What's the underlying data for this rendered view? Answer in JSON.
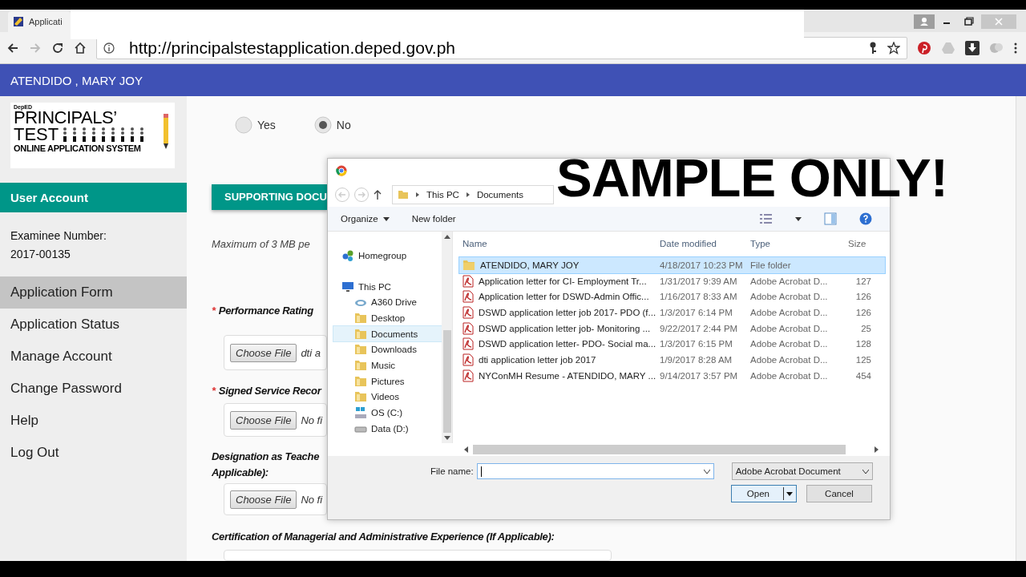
{
  "browser": {
    "tab_title": "Applicati",
    "url": "http://principalstestapplication.deped.gov.ph"
  },
  "header": {
    "user_name": "ATENDIDO , MARY JOY"
  },
  "sidebar": {
    "logo": {
      "agency": "DepED",
      "line1": "PRINCIPALS’",
      "line2": "TEST",
      "line3": "ONLINE APPLICATION SYSTEM"
    },
    "section_title": "User Account",
    "examinee_label": "Examinee Number:",
    "examinee_number": "2017-00135",
    "items": [
      {
        "label": "Application Form",
        "selected": true
      },
      {
        "label": "Application Status",
        "selected": false
      },
      {
        "label": "Manage Account",
        "selected": false
      },
      {
        "label": "Change Password",
        "selected": false
      },
      {
        "label": "Help",
        "selected": false
      },
      {
        "label": "Log Out",
        "selected": false
      }
    ]
  },
  "form": {
    "radios": [
      {
        "label": "Yes",
        "selected": false
      },
      {
        "label": "No",
        "selected": true
      }
    ],
    "section_button": "SUPPORTING DOCU",
    "note": "Maximum of 3 MB pe",
    "fields": [
      {
        "mark": "*",
        "label_lines": [
          "Performance Rating"
        ],
        "button": "Choose File",
        "file": "dti a"
      },
      {
        "mark": "*",
        "label_lines": [
          "Signed Service Recor"
        ],
        "button": "Choose File",
        "file": "No fi"
      },
      {
        "label_lines": [
          "Designation as Teache",
          "Applicable):"
        ],
        "button": "Choose File",
        "file": "No fi"
      },
      {
        "label_lines": [
          "Certification of Managerial and Administrative Experience (If Applicable):"
        ]
      }
    ]
  },
  "dialog": {
    "breadcrumb": [
      "This PC",
      "Documents"
    ],
    "toolbar": [
      "Organize",
      "New folder"
    ],
    "nav": [
      {
        "label": "Homegroup",
        "kind": "homegroup",
        "selected": false
      },
      {
        "label": "This PC",
        "kind": "pc",
        "selected": false,
        "children": [
          {
            "label": "A360 Drive",
            "kind": "cloud",
            "selected": false
          },
          {
            "label": "Desktop",
            "kind": "folder",
            "selected": false
          },
          {
            "label": "Documents",
            "kind": "folder",
            "selected": true
          },
          {
            "label": "Downloads",
            "kind": "folder",
            "selected": false
          },
          {
            "label": "Music",
            "kind": "folder",
            "selected": false
          },
          {
            "label": "Pictures",
            "kind": "folder",
            "selected": false
          },
          {
            "label": "Videos",
            "kind": "folder",
            "selected": false
          },
          {
            "label": "OS (C:)",
            "kind": "os-drive",
            "selected": false
          },
          {
            "label": "Data (D:)",
            "kind": "drive",
            "selected": false
          }
        ]
      }
    ],
    "columns": [
      "Name",
      "Date modified",
      "Type",
      "Size"
    ],
    "rows": [
      {
        "kind": "folder",
        "name": "ATENDIDO, MARY JOY",
        "date": "4/18/2017 10:23 PM",
        "type": "File folder",
        "selected": true
      },
      {
        "kind": "pdf",
        "name": "Application letter for CI- Employment Tr...",
        "date": "1/31/2017 9:39 AM",
        "type": "Adobe Acrobat D...",
        "size": "127",
        "selected": false
      },
      {
        "kind": "pdf",
        "name": "Application letter for DSWD-Admin Offic...",
        "date": "1/16/2017 8:33 AM",
        "type": "Adobe Acrobat D...",
        "size": "126",
        "selected": false
      },
      {
        "kind": "pdf",
        "name": "DSWD application letter job 2017- PDO (f...",
        "date": "1/3/2017 6:14 PM",
        "type": "Adobe Acrobat D...",
        "size": "126",
        "selected": false
      },
      {
        "kind": "pdf",
        "name": "DSWD application letter job- Monitoring ...",
        "date": "9/22/2017 2:44 PM",
        "type": "Adobe Acrobat D...",
        "size": "25",
        "selected": false
      },
      {
        "kind": "pdf",
        "name": "DSWD application letter- PDO- Social ma...",
        "date": "1/3/2017 6:15 PM",
        "type": "Adobe Acrobat D...",
        "size": "128",
        "selected": false
      },
      {
        "kind": "pdf",
        "name": "dti application letter job 2017",
        "date": "1/9/2017 8:28 AM",
        "type": "Adobe Acrobat D...",
        "size": "125",
        "selected": false
      },
      {
        "kind": "pdf",
        "name": "NYConMH Resume - ATENDIDO, MARY ...",
        "date": "9/14/2017 3:57 PM",
        "type": "Adobe Acrobat D...",
        "size": "454",
        "selected": false
      }
    ],
    "file_name_label": "File name:",
    "file_type": "Adobe Acrobat Document",
    "buttons": [
      {
        "label": "Open",
        "kind": "primary"
      },
      {
        "label": "Cancel",
        "kind": "normal"
      }
    ]
  },
  "overlay_caption": "SAMPLE ONLY!"
}
